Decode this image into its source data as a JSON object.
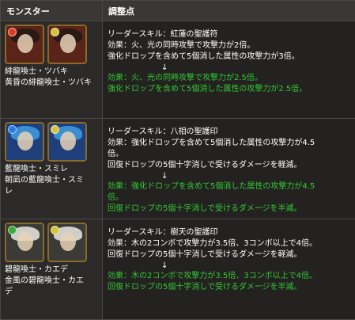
{
  "header": {
    "col1": "モンスター",
    "col2": "調整点"
  },
  "rows": [
    {
      "monster_lines": [
        "緋龍喚士・ツバキ",
        "黄昏の緋龍喚士・ツバキ"
      ],
      "before": [
        "リーダースキル：紅蓮の聖護符",
        "効果：火、光の同時攻撃で攻撃力が2倍。",
        "強化ドロップを含めて5個消した属性の攻撃力が3倍。"
      ],
      "arrow": "↓",
      "after": [
        "効果：火、光の同時攻撃で攻撃力が2.5倍。",
        "強化ドロップを含めて5個消した属性の攻撃力が2.5倍。"
      ]
    },
    {
      "monster_lines": [
        "藍龍喚士・スミレ",
        "朝凪の藍龍喚士・スミ",
        "レ"
      ],
      "before": [
        "リーダースキル：八相の聖護印",
        "効果：強化ドロップを含めて5個消した属性の攻撃力が4.5",
        "倍。",
        "回復ドロップの5個十字消しで受けるダメージを軽減。"
      ],
      "arrow": "↓",
      "after": [
        "効果：強化ドロップを含めて5個消した属性の攻撃力が4.5",
        "倍。",
        "回復ドロップの5個十字消しで受けるダメージを半減。"
      ]
    },
    {
      "monster_lines": [
        "碧龍喚士・カエデ",
        "金風の碧龍喚士・カエ",
        "デ"
      ],
      "before": [
        "リーダースキル：樹天の聖護印",
        "効果：木の2コンボで攻撃力が3.5倍、3コンボ以上で4倍。",
        "回復ドロップの5個十字消しで受けるダメージを軽減。"
      ],
      "arrow": "↓",
      "after": [
        "効果：木の2コンボで攻撃力が3.5倍、3コンボ以上で4倍。",
        "回復ドロップの5個十字消しで受けるダメージを半減。"
      ]
    }
  ],
  "icons": [
    {
      "name": "tsubaki",
      "bg": "#5a2418",
      "hair": "#2a1a14",
      "orbs": [
        "#e23b1f",
        "#d8c23a"
      ]
    },
    {
      "name": "sumire",
      "bg": "#1e3f7a",
      "hair": "#3a8fd0",
      "orbs": [
        "#2a7ae0",
        "#d8c23a"
      ]
    },
    {
      "name": "kaede",
      "bg": "#3a3a36",
      "hair": "#cfcfc8",
      "orbs": [
        "#3aa83a",
        "#d8c23a"
      ]
    }
  ]
}
